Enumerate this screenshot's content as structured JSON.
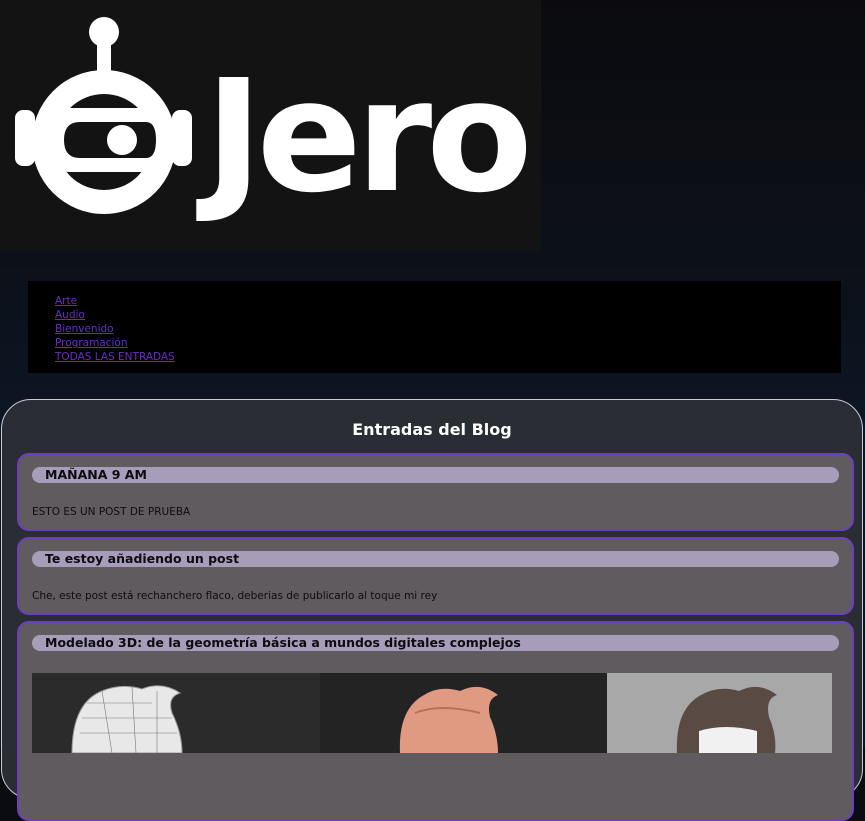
{
  "logo": {
    "text": "Jero",
    "icon": "robot-head-icon"
  },
  "nav": {
    "items": [
      "Arte",
      "Audio",
      "Bienvenido",
      "Programación",
      "TODAS LAS ENTRADAS"
    ]
  },
  "blog": {
    "title": "Entradas del Blog",
    "posts": [
      {
        "title": "MAÑANA 9 AM",
        "body": "ESTO ES UN POST DE PRUEBA"
      },
      {
        "title": "Te estoy añadiendo un post",
        "body": "Che, este post está rechanchero flaco, deberias de publicarlo al toque mi rey"
      },
      {
        "title": "Modelado 3D: de la geometría básica a mundos digitales complejos",
        "image": "3d-character-renders"
      }
    ]
  },
  "colors": {
    "link": "#6a2bc4",
    "post_border": "#6c3fc1",
    "post_bg": "#5f5b5e",
    "post_title_bg": "#a79db8"
  }
}
